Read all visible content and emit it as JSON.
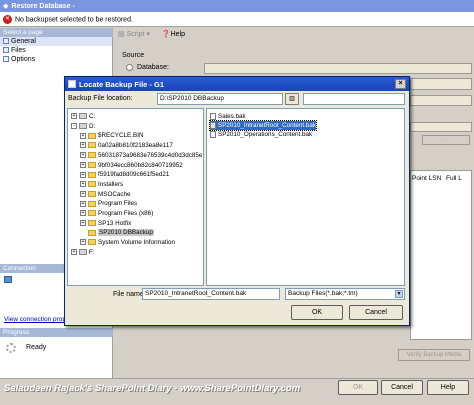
{
  "outer": {
    "title": "Restore Database -",
    "error_text": "No backupset selected to be restored.",
    "select_page": "Select a page",
    "pages": [
      "General",
      "Files",
      "Options"
    ],
    "connection_head": "Connection",
    "view_connection": "View connection prop",
    "progress_head": "Progress",
    "progress_status": "Ready",
    "toolbar": {
      "script": "Script",
      "help": "Help"
    },
    "source_label": "Source",
    "database_label": "Database:",
    "col_point_lsn": "Point LSN",
    "col_full": "Full L",
    "verify_button": "Verify Backup Media",
    "buttons": {
      "ok": "OK",
      "cancel": "Cancel",
      "help": "Help"
    },
    "watermark": "Salaudeen Rajack's SharePoint Diary - www.SharePointDiary.com"
  },
  "dialog": {
    "title": "Locate Backup File - G1",
    "location_label": "Backup File location:",
    "location_value": "D:\\SP2010 DBBackup",
    "tree": [
      {
        "label": "C:",
        "kind": "drive",
        "expander": "+",
        "level": 0
      },
      {
        "label": "D:",
        "kind": "drive",
        "expander": "-",
        "level": 0
      },
      {
        "label": "$RECYCLE.BIN",
        "kind": "folder",
        "expander": "+",
        "level": 1
      },
      {
        "label": "0a02a8b810f2183ea8e117",
        "kind": "folder",
        "expander": "+",
        "level": 1
      },
      {
        "label": "56031873a9683e76539c4d0d3dc85e",
        "kind": "folder",
        "expander": "+",
        "level": 1
      },
      {
        "label": "9bf034ecc860b82c840719952",
        "kind": "folder",
        "expander": "+",
        "level": 1
      },
      {
        "label": "f5919fad8d09c661f5ed21",
        "kind": "folder",
        "expander": "+",
        "level": 1
      },
      {
        "label": "Installers",
        "kind": "folder",
        "expander": "+",
        "level": 1
      },
      {
        "label": "MSOCache",
        "kind": "folder",
        "expander": "+",
        "level": 1
      },
      {
        "label": "Program Files",
        "kind": "folder",
        "expander": "+",
        "level": 1
      },
      {
        "label": "Program Files (x86)",
        "kind": "folder",
        "expander": "+",
        "level": 1
      },
      {
        "label": "SP13 Hotfix",
        "kind": "folder",
        "expander": "+",
        "level": 1
      },
      {
        "label": "SP2010 DBBackup",
        "kind": "folder",
        "expander": "",
        "level": 1,
        "selected": true
      },
      {
        "label": "System Volume Information",
        "kind": "folder",
        "expander": "+",
        "level": 1
      },
      {
        "label": "F:",
        "kind": "drive",
        "expander": "+",
        "level": 0
      }
    ],
    "files": [
      {
        "label": "Sales.bak",
        "selected": false
      },
      {
        "label": "SP2010_IntranetRoot_Content.bak",
        "selected": true
      },
      {
        "label": "SP2010_Operations_Content.bak",
        "selected": false
      }
    ],
    "file_name_label": "File name:",
    "file_name_value": "SP2010_IntranetRoot_Content.bak",
    "file_type_value": "Backup Files(*.bak;*.tm)",
    "ok": "OK",
    "cancel": "Cancel"
  }
}
